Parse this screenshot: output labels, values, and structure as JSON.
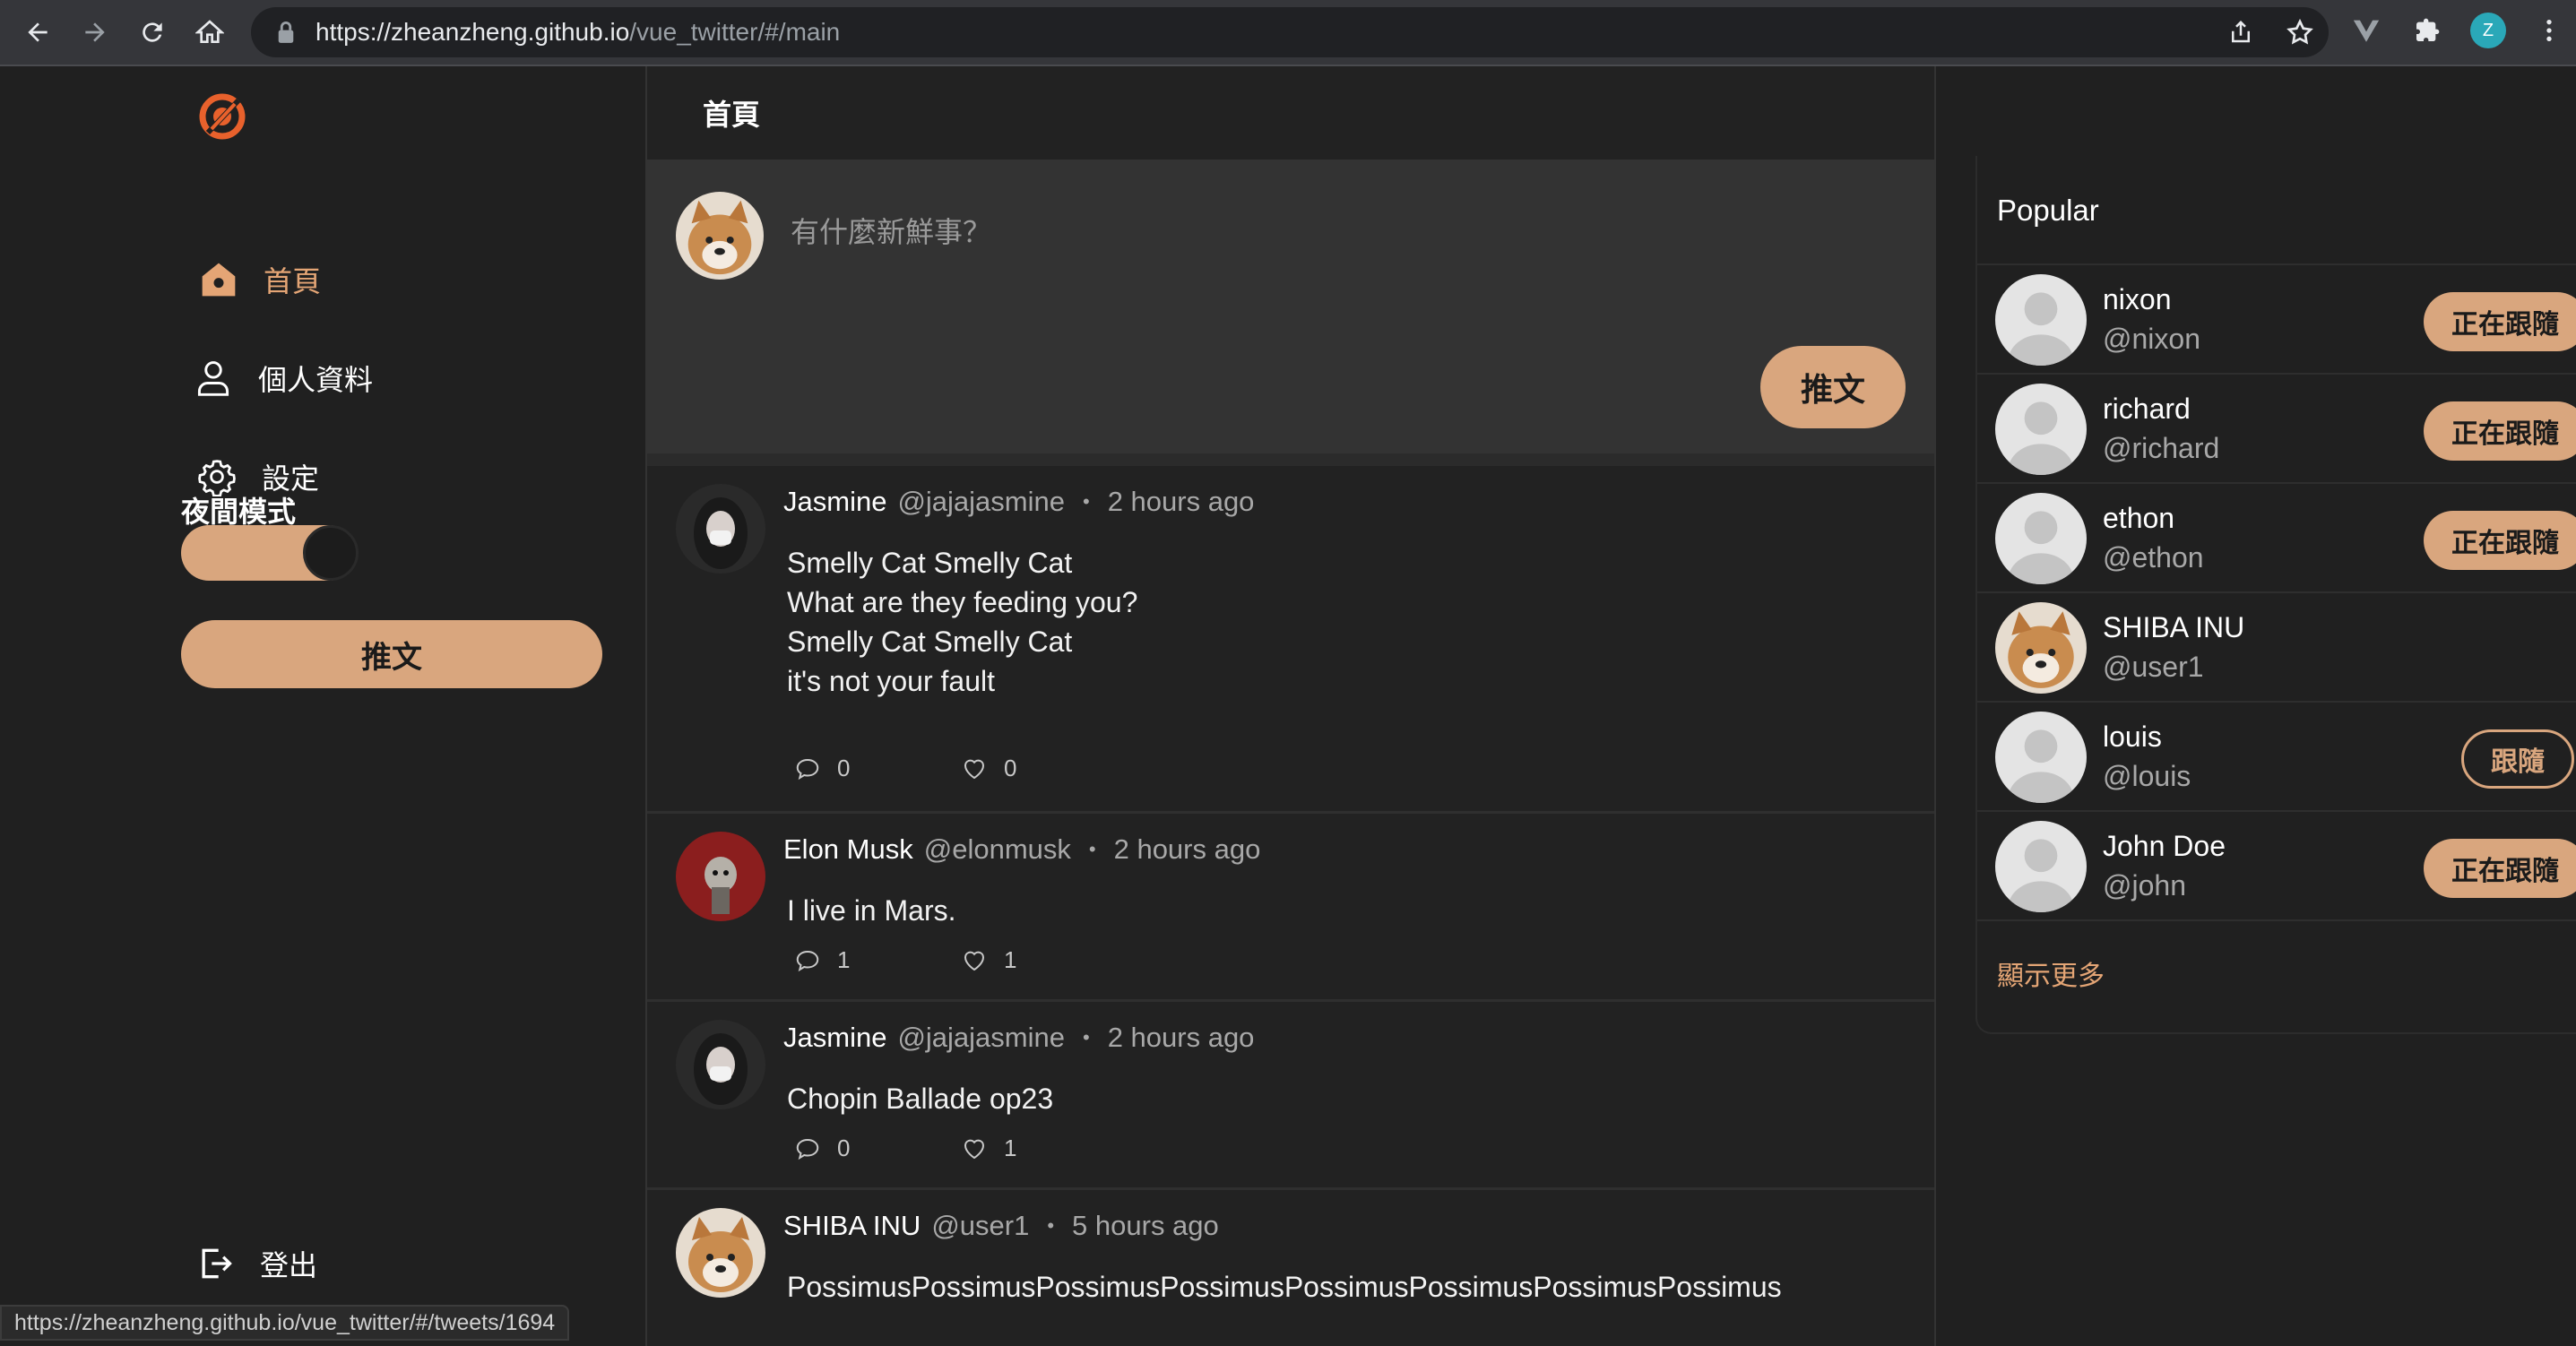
{
  "browser": {
    "url_host": "https://zheanzheng.github.io",
    "url_path": "/vue_twitter/#/main",
    "profile_initial": "Z",
    "status_url": "https://zheanzheng.github.io/vue_twitter/#/tweets/1694"
  },
  "sidebar": {
    "items": [
      {
        "label": "首頁",
        "icon": "home-icon",
        "active": true
      },
      {
        "label": "個人資料",
        "icon": "user-icon",
        "active": false
      },
      {
        "label": "設定",
        "icon": "gear-icon",
        "active": false
      }
    ],
    "night_mode_label": "夜間模式",
    "night_mode_on": true,
    "tweet_button": "推文",
    "logout_label": "登出"
  },
  "main": {
    "title": "首頁",
    "composer_placeholder": "有什麼新鮮事？",
    "composer_button": "推文"
  },
  "tweets": [
    {
      "name": "Jasmine",
      "handle": "@jajajasmine",
      "time": "2 hours ago",
      "body": "Smelly Cat Smelly Cat\nWhat are they feeding you?\nSmelly Cat Smelly Cat\nit's not your fault",
      "replies": "0",
      "likes": "0",
      "avatar": "jasmine"
    },
    {
      "name": "Elon Musk",
      "handle": "@elonmusk",
      "time": "2 hours ago",
      "body": "I live in Mars.",
      "replies": "1",
      "likes": "1",
      "avatar": "elon"
    },
    {
      "name": "Jasmine",
      "handle": "@jajajasmine",
      "time": "2 hours ago",
      "body": "Chopin Ballade op23",
      "replies": "0",
      "likes": "1",
      "avatar": "jasmine"
    },
    {
      "name": "SHIBA INU",
      "handle": "@user1",
      "time": "5 hours ago",
      "body": "PossimusPossimusPossimusPossimusPossimusPossimusPossimusPossimus",
      "replies": "",
      "likes": "",
      "avatar": "shiba"
    }
  ],
  "popular": {
    "title": "Popular",
    "users": [
      {
        "name": "nixon",
        "handle": "@nixon",
        "button": "正在跟隨",
        "state": "following",
        "avatar": "default"
      },
      {
        "name": "richard",
        "handle": "@richard",
        "button": "正在跟隨",
        "state": "following",
        "avatar": "default"
      },
      {
        "name": "ethon",
        "handle": "@ethon",
        "button": "正在跟隨",
        "state": "following",
        "avatar": "default"
      },
      {
        "name": "SHIBA INU",
        "handle": "@user1",
        "button": "",
        "state": "self",
        "avatar": "shiba"
      },
      {
        "name": "louis",
        "handle": "@louis",
        "button": "跟隨",
        "state": "follow",
        "avatar": "default"
      },
      {
        "name": "John Doe",
        "handle": "@john",
        "button": "正在跟隨",
        "state": "following",
        "avatar": "default"
      }
    ],
    "show_more": "顯示更多"
  },
  "colors": {
    "accent": "#d9a67e",
    "accent_text": "#e4a575",
    "background": "#202020",
    "card": "#333333"
  }
}
